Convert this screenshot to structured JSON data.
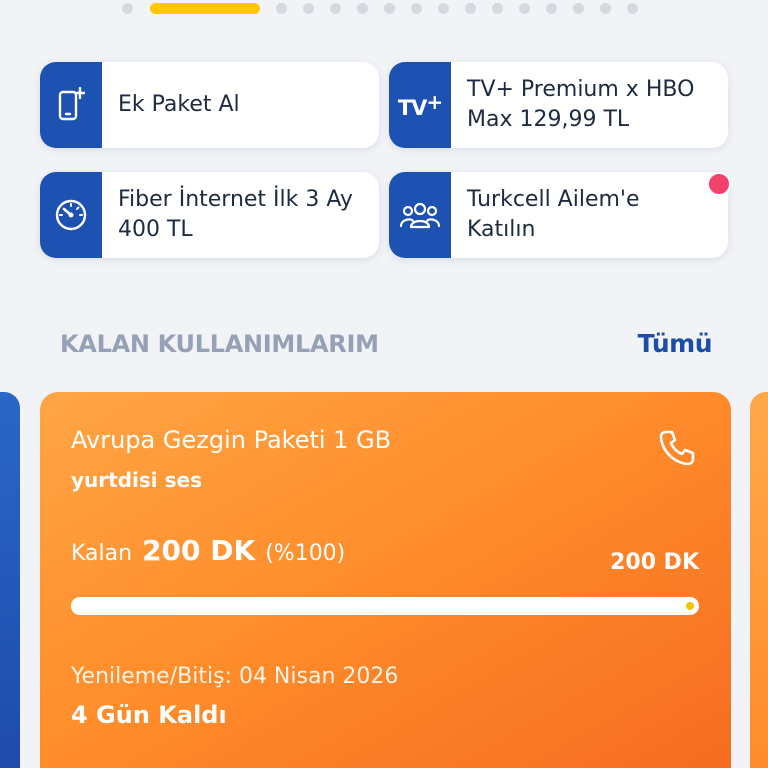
{
  "pager": {
    "count": 17,
    "active_index": 1
  },
  "quick_actions": [
    {
      "label": "Ek Paket Al",
      "icon": "phone-plus-icon"
    },
    {
      "label": "TV+ Premium x HBO Max 129,99 TL",
      "icon": "tv-plus-icon"
    },
    {
      "label": "Fiber İnternet İlk 3 Ay 400 TL",
      "icon": "speedometer-icon"
    },
    {
      "label": "Turkcell Ailem'e Katılın",
      "icon": "family-icon",
      "has_notification": true
    }
  ],
  "tv_logo_text": "TV",
  "tv_logo_plus": "+",
  "remaining_section": {
    "title": "KALAN KULLANIMLARIM",
    "see_all": "Tümü"
  },
  "usage_card": {
    "package_name": "Avrupa Gezgin Paketi 1 GB",
    "package_type": "yurtdisi ses",
    "icon": "phone-icon",
    "remaining_label": "Kalan",
    "remaining_value": "200 DK",
    "remaining_percent": "(%100)",
    "total": "200 DK",
    "progress": 1.0,
    "renewal": "Yenileme/Bitiş: 04 Nisan 2026",
    "days_left": "4 Gün Kaldı"
  },
  "colors": {
    "brand_blue": "#1d52b2",
    "accent_yellow": "#ffc800",
    "card_orange": "#ff8d2b",
    "notification": "#f2416a"
  }
}
